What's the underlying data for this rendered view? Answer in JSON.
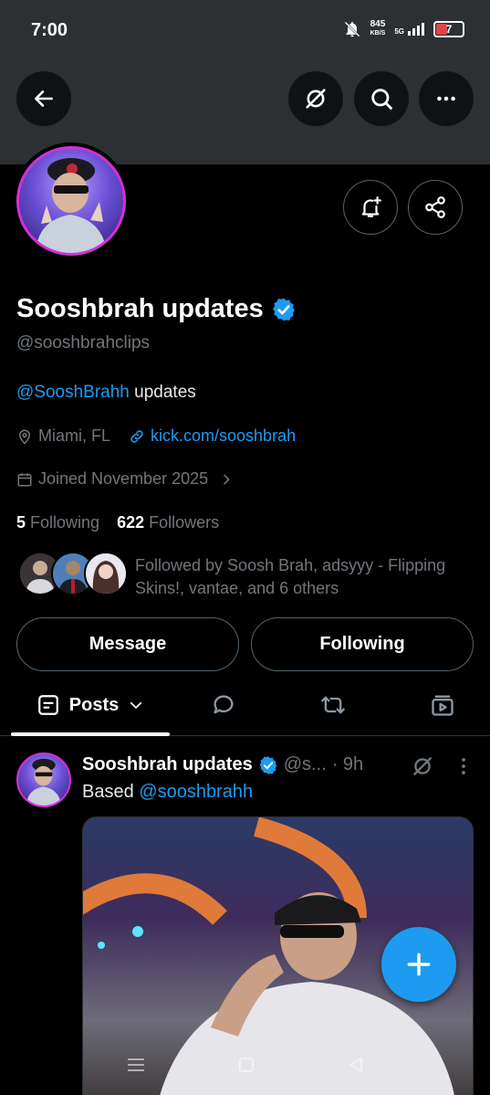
{
  "status_bar": {
    "time": "7:00",
    "net_speed": "845",
    "net_unit": "KB/S",
    "network": "5G",
    "battery": "7",
    "battery_color": "#e0454a"
  },
  "header": {
    "back_icon": "arrow-left-icon",
    "grok_icon": "grok-icon",
    "search_icon": "search-icon",
    "more_icon": "more-icon"
  },
  "profile": {
    "display_name": "Sooshbrah updates",
    "handle": "@sooshbrahclips",
    "bio_mention": "@SooshBrahh",
    "bio_text": " updates",
    "location": "Miami, FL",
    "website": "kick.com/sooshbrah",
    "joined": "Joined November 2025",
    "following_count": "5",
    "following_label": "Following",
    "followers_count": "622",
    "followers_label": "Followers",
    "followed_by": "Followed by Soosh Brah, adsyyy - Flipping Skins!, vantae, and 6 others",
    "verified_color": "#1d9bf0",
    "accent_ring": "#d330d9"
  },
  "actions": {
    "message_label": "Message",
    "following_label": "Following"
  },
  "tabs": {
    "posts_label": "Posts",
    "items": [
      "posts-icon",
      "replies-icon",
      "reposts-icon",
      "media-icon"
    ]
  },
  "post": {
    "author_name": "Sooshbrah updates",
    "author_handle": "@s...",
    "time": "· 9h",
    "text_prefix": "Based ",
    "mention": "@sooshbrahh"
  },
  "fab": {
    "icon": "plus-icon",
    "color": "#1d9bf0"
  }
}
